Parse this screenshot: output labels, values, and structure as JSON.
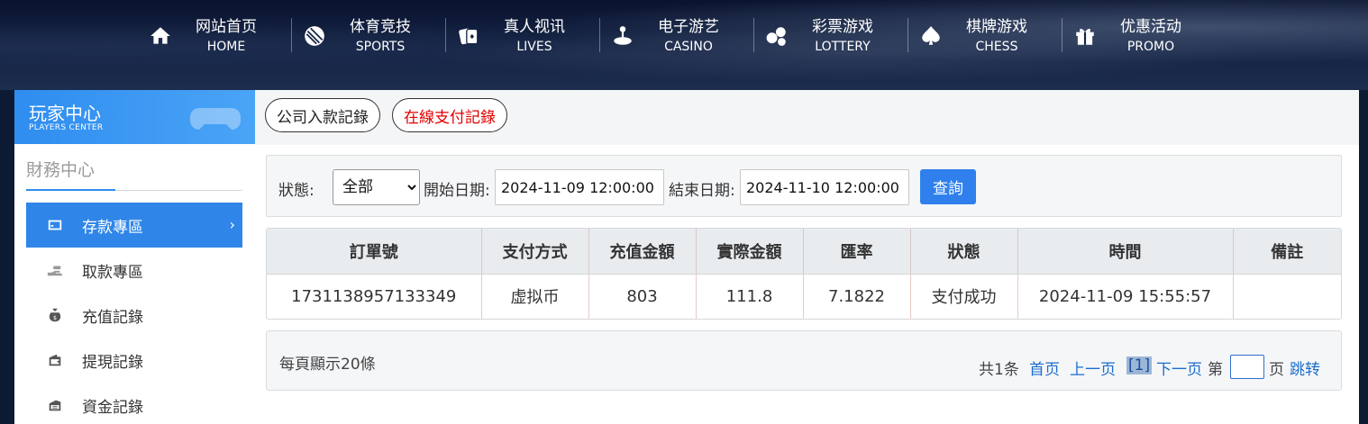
{
  "nav": [
    {
      "zh": "网站首页",
      "en": "HOME",
      "icon": "home-icon"
    },
    {
      "zh": "体育竞技",
      "en": "SPORTS",
      "icon": "ball-icon"
    },
    {
      "zh": "真人视讯",
      "en": "LIVES",
      "icon": "cards-icon"
    },
    {
      "zh": "电子游艺",
      "en": "CASINO",
      "icon": "joystick-icon"
    },
    {
      "zh": "彩票游戏",
      "en": "LOTTERY",
      "icon": "lottery-balls-icon"
    },
    {
      "zh": "棋牌游戏",
      "en": "CHESS",
      "icon": "spade-icon"
    },
    {
      "zh": "优惠活动",
      "en": "PROMO",
      "icon": "gift-icon"
    }
  ],
  "sidebar": {
    "title_zh": "玩家中心",
    "title_en": "PLAYERS CENTER",
    "section": "財務中心",
    "items": [
      {
        "label": "存款專區",
        "icon": "deposit-card-icon",
        "active": true
      },
      {
        "label": "取款專區",
        "icon": "withdraw-hand-icon"
      },
      {
        "label": "充值記錄",
        "icon": "money-bag-icon"
      },
      {
        "label": "提現記錄",
        "icon": "wallet-icon"
      },
      {
        "label": "資金記錄",
        "icon": "funds-icon"
      }
    ]
  },
  "tabs": {
    "company": "公司入款記錄",
    "online": "在線支付記錄"
  },
  "filter": {
    "status_label": "狀態:",
    "status_value": "全部",
    "start_label": "開始日期:",
    "start_value": "2024-11-09 12:00:00",
    "end_label": "結束日期:",
    "end_value": "2024-11-10 12:00:00",
    "query_button": "查詢"
  },
  "table": {
    "headers": [
      "訂單號",
      "支付方式",
      "充值金額",
      "實際金額",
      "匯率",
      "狀態",
      "時間",
      "備註"
    ],
    "rows": [
      [
        "1731138957133349",
        "虚拟币",
        "803",
        "111.8",
        "7.1822",
        "支付成功",
        "2024-11-09 15:55:57",
        ""
      ]
    ]
  },
  "pager": {
    "per_page": "每頁顯示20條",
    "total": "共1条",
    "first": "首页",
    "prev": "上一页",
    "current": "[1]",
    "next": "下一页",
    "goto_prefix": "第",
    "goto_suffix": "页",
    "jump": "跳转"
  },
  "colors": {
    "accent": "#2f86e8",
    "active_tab_text": "#e00000",
    "link": "#1a6dcc"
  }
}
